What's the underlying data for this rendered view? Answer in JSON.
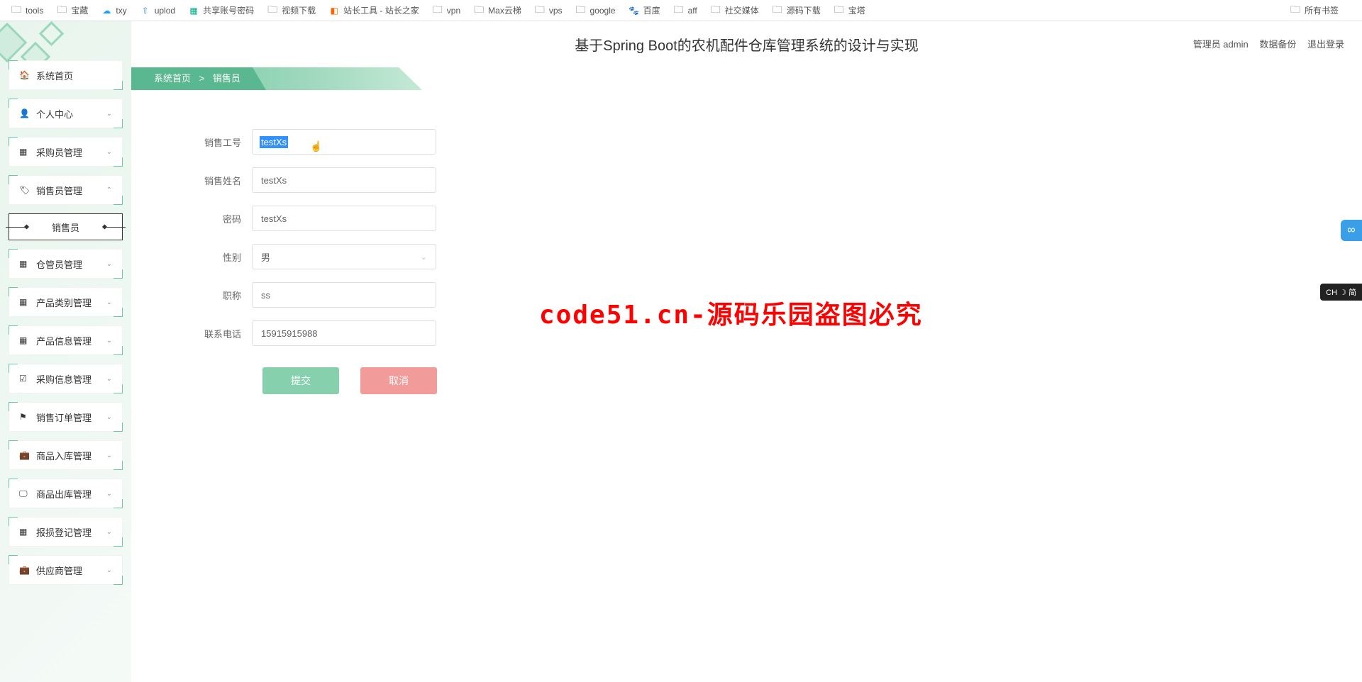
{
  "bookmarks": {
    "left": [
      {
        "icon": "folder",
        "label": "tools"
      },
      {
        "icon": "folder",
        "label": "宝藏"
      },
      {
        "icon": "cloud",
        "label": "txy"
      },
      {
        "icon": "upload",
        "label": "uplod"
      },
      {
        "icon": "sheet",
        "label": "共享账号密码"
      },
      {
        "icon": "folder",
        "label": "视频下载"
      },
      {
        "icon": "tool",
        "label": "站长工具 - 站长之家"
      },
      {
        "icon": "folder",
        "label": "vpn"
      },
      {
        "icon": "folder",
        "label": "Max云梯"
      },
      {
        "icon": "folder",
        "label": "vps"
      },
      {
        "icon": "folder",
        "label": "google"
      },
      {
        "icon": "baidu",
        "label": "百度"
      },
      {
        "icon": "folder",
        "label": "aff"
      },
      {
        "icon": "folder",
        "label": "社交媒体"
      },
      {
        "icon": "folder",
        "label": "源码下载"
      },
      {
        "icon": "folder",
        "label": "宝塔"
      }
    ],
    "right": {
      "icon": "folder",
      "label": "所有书签"
    }
  },
  "header": {
    "title": "基于Spring Boot的农机配件仓库管理系统的设计与实现",
    "user_role": "管理员 admin",
    "backup": "数据备份",
    "logout": "退出登录"
  },
  "breadcrumb": {
    "home": "系统首页",
    "sep": ">",
    "current": "销售员"
  },
  "sidebar": {
    "items": [
      {
        "icon": "🏠",
        "label": "系统首页",
        "expandable": false
      },
      {
        "icon": "👤",
        "label": "个人中心",
        "expandable": true
      },
      {
        "icon": "▦",
        "label": "采购员管理",
        "expandable": true
      },
      {
        "icon": "🏷",
        "label": "销售员管理",
        "expandable": true,
        "expanded": true
      },
      {
        "icon": "▦",
        "label": "仓管员管理",
        "expandable": true
      },
      {
        "icon": "▦",
        "label": "产品类别管理",
        "expandable": true
      },
      {
        "icon": "▦",
        "label": "产品信息管理",
        "expandable": true
      },
      {
        "icon": "☑",
        "label": "采购信息管理",
        "expandable": true
      },
      {
        "icon": "⚑",
        "label": "销售订单管理",
        "expandable": true
      },
      {
        "icon": "💼",
        "label": "商品入库管理",
        "expandable": true
      },
      {
        "icon": "🖵",
        "label": "商品出库管理",
        "expandable": true
      },
      {
        "icon": "▦",
        "label": "报损登记管理",
        "expandable": true
      },
      {
        "icon": "💼",
        "label": "供应商管理",
        "expandable": true
      }
    ],
    "submenu": "销售员"
  },
  "form": {
    "fields": {
      "sales_id": {
        "label": "销售工号",
        "value": "testXs"
      },
      "sales_name": {
        "label": "销售姓名",
        "value": "testXs"
      },
      "password": {
        "label": "密码",
        "value": "testXs"
      },
      "gender": {
        "label": "性别",
        "value": "男"
      },
      "title": {
        "label": "职称",
        "value": "ss"
      },
      "phone": {
        "label": "联系电话",
        "value": "15915915988"
      }
    },
    "submit": "提交",
    "cancel": "取消"
  },
  "watermark": "code51.cn-源码乐园盗图必究",
  "ime": "CH ☽ 简"
}
